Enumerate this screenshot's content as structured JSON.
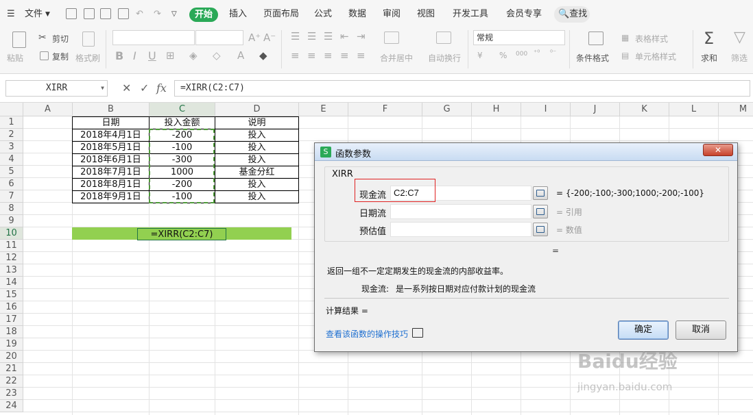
{
  "tabs": {
    "file": "文件",
    "items": [
      "开始",
      "插入",
      "页面布局",
      "公式",
      "数据",
      "审阅",
      "视图",
      "开发工具",
      "会员专享"
    ],
    "search": "查找"
  },
  "ribbon": {
    "paste": "粘贴",
    "cut": "剪切",
    "copy": "复制",
    "format_painter": "格式刷",
    "number_format": "常规",
    "merge_center": "合并居中",
    "wrap_text": "自动换行",
    "table_style": "表格样式",
    "cell_style": "单元格样式",
    "cond_format": "条件格式",
    "sum": "求和",
    "filter": "筛选",
    "percent": "%",
    "thousands": "000",
    "yen": "¥"
  },
  "formula_bar": {
    "namebox": "XIRR",
    "fx": "fx",
    "formula": "=XIRR(C2:C7)"
  },
  "columns": [
    "A",
    "B",
    "C",
    "D",
    "E",
    "F",
    "G",
    "H",
    "I",
    "J",
    "K",
    "L",
    "M"
  ],
  "rows": [
    "1",
    "2",
    "3",
    "4",
    "5",
    "6",
    "7",
    "8",
    "9",
    "10",
    "11",
    "12",
    "13",
    "14",
    "15",
    "16",
    "17",
    "18",
    "19",
    "20",
    "21",
    "22",
    "23",
    "24"
  ],
  "table": {
    "headers": [
      "日期",
      "投入金额",
      "说明"
    ],
    "rows": [
      [
        "2018年4月1日",
        "-200",
        "投入"
      ],
      [
        "2018年5月1日",
        "-100",
        "投入"
      ],
      [
        "2018年6月1日",
        "-300",
        "投入"
      ],
      [
        "2018年7月1日",
        "1000",
        "基金分红"
      ],
      [
        "2018年8月1日",
        "-200",
        "投入"
      ],
      [
        "2018年9月1日",
        "-100",
        "投入"
      ]
    ]
  },
  "c10_formula": "=XIRR(C2:C7)",
  "dialog": {
    "title": "函数参数",
    "close": "✕",
    "function": "XIRR",
    "args": [
      {
        "label": "现金流",
        "value": "C2:C7",
        "result": "= {-200;-100;-300;1000;-200;-100}"
      },
      {
        "label": "日期流",
        "value": "",
        "result": "= 引用"
      },
      {
        "label": "预估值",
        "value": "",
        "result": "= 数值"
      }
    ],
    "result_eq": "=",
    "description": "返回一组不一定定期发生的现金流的内部收益率。",
    "arg_help_label": "现金流:",
    "arg_help": "是一系列按日期对应付款计划的现金流",
    "calc_result": "计算结果 =",
    "link": "查看该函数的操作技巧",
    "ok": "确定",
    "cancel": "取消"
  },
  "watermark": {
    "brand": "Baidu经验",
    "url": "jingyan.baidu.com"
  }
}
